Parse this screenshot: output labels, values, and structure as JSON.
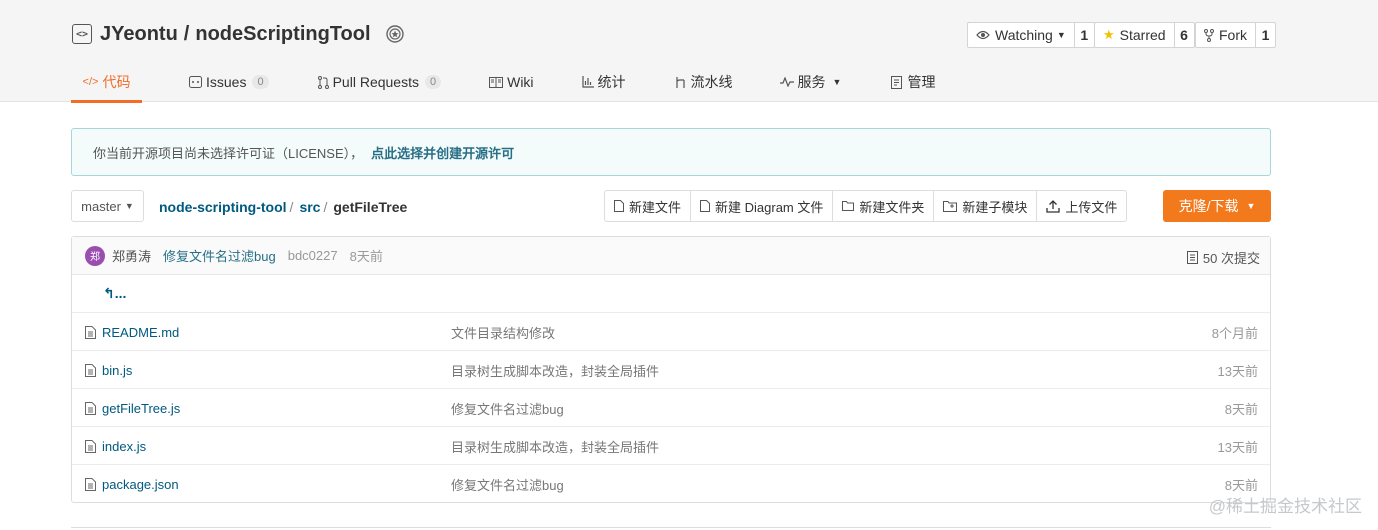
{
  "repo": {
    "owner": "JYeontu",
    "separator": "/",
    "name": "nodeScriptingTool"
  },
  "actions": {
    "watch": {
      "label": "Watching",
      "count": "1"
    },
    "star": {
      "label": "Starred",
      "count": "6"
    },
    "fork": {
      "label": "Fork",
      "count": "1"
    }
  },
  "tabs": [
    {
      "label": "代码",
      "icon": "code-icon"
    },
    {
      "label": "Issues",
      "count": "0",
      "icon": "issues-icon"
    },
    {
      "label": "Pull Requests",
      "count": "0",
      "icon": "pull-request-icon"
    },
    {
      "label": "Wiki",
      "icon": "book-icon"
    },
    {
      "label": "统计",
      "icon": "chart-icon"
    },
    {
      "label": "流水线",
      "icon": "pipeline-icon"
    },
    {
      "label": "服务",
      "icon": "pulse-icon"
    },
    {
      "label": "管理",
      "icon": "settings-doc-icon"
    }
  ],
  "notice": {
    "text": "你当前开源项目尚未选择许可证（LICENSE），",
    "link": "点此选择并创建开源许可"
  },
  "branch": {
    "name": "master"
  },
  "breadcrumb": {
    "repo": "node-scripting-tool",
    "sep": "/",
    "dir": "src",
    "current": "getFileTree"
  },
  "toolbar": {
    "new_file": "新建文件",
    "new_diagram": "新建 Diagram 文件",
    "new_folder": "新建文件夹",
    "new_submodule": "新建子模块",
    "upload": "上传文件",
    "clone": "克隆/下载"
  },
  "commit": {
    "avatar_char": "郑",
    "author": "郑勇涛",
    "message": "修复文件名过滤bug",
    "sha": "bdc0227",
    "time": "8天前",
    "count_label": "50 次提交"
  },
  "back_label": "...",
  "files": [
    {
      "name": "README.md",
      "message": "文件目录结构修改",
      "time": "8个月前"
    },
    {
      "name": "bin.js",
      "message": "目录树生成脚本改造，封装全局插件",
      "time": "13天前"
    },
    {
      "name": "getFileTree.js",
      "message": "修复文件名过滤bug",
      "time": "8天前"
    },
    {
      "name": "index.js",
      "message": "目录树生成脚本改造，封装全局插件",
      "time": "13天前"
    },
    {
      "name": "package.json",
      "message": "修复文件名过滤bug",
      "time": "8天前"
    }
  ],
  "watermark": "@稀土掘金技术社区",
  "colors": {
    "accent": "#f36d28",
    "clone_button": "#f3791d",
    "link": "#005980"
  }
}
